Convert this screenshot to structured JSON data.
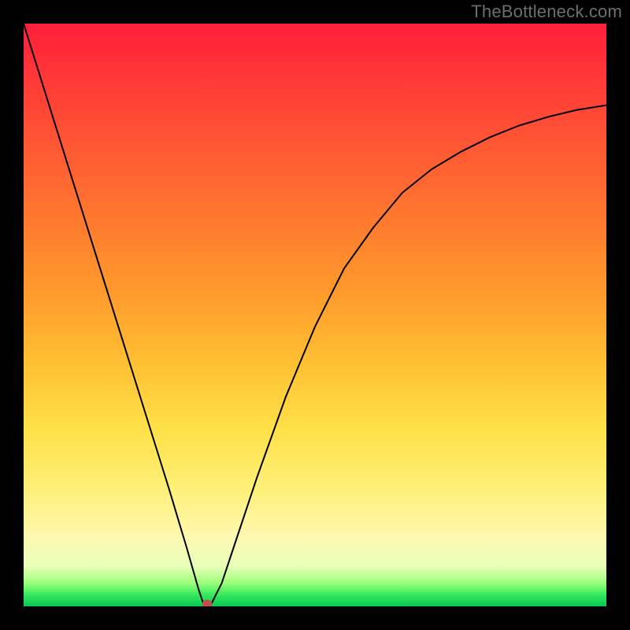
{
  "watermark": "TheBottleneck.com",
  "chart_data": {
    "type": "line",
    "title": "",
    "xlabel": "",
    "ylabel": "",
    "xlim": [
      0,
      100
    ],
    "ylim": [
      0,
      100
    ],
    "grid": false,
    "legend": false,
    "series": [
      {
        "name": "bottleneck-curve",
        "x": [
          0,
          5,
          10,
          15,
          20,
          25,
          28,
          30,
          31,
          32,
          34,
          36,
          40,
          45,
          50,
          55,
          60,
          65,
          70,
          75,
          80,
          85,
          90,
          95,
          100
        ],
        "y": [
          100,
          84,
          68,
          52,
          36,
          20,
          10,
          3,
          0,
          0,
          4,
          10,
          22,
          36,
          48,
          58,
          65,
          71,
          75,
          78,
          80.5,
          82.5,
          84,
          85.2,
          86
        ]
      }
    ],
    "marker": {
      "x": 31.5,
      "y": 0
    },
    "background_gradient": {
      "top": "#ff1f3a",
      "mid": "#ffe24a",
      "bottom": "#07c94f"
    }
  }
}
